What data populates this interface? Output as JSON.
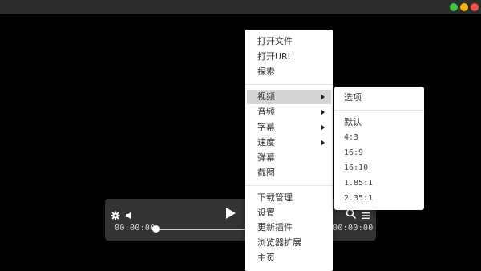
{
  "window": {
    "controls": [
      {
        "name": "green",
        "color": "#3fc24a"
      },
      {
        "name": "yellow",
        "color": "#f5b400"
      },
      {
        "name": "red",
        "color": "#f2504b"
      }
    ]
  },
  "player": {
    "current_time": "00:00:00",
    "total_time": "00:00:00",
    "progress": 0,
    "icons": [
      "gear-icon",
      "volume-icon",
      "play-icon",
      "search-icon",
      "playlist-icon"
    ]
  },
  "context_menu": {
    "items": [
      {
        "label": "打开文件"
      },
      {
        "label": "打开URL"
      },
      {
        "label": "探索"
      },
      {
        "label": "视频",
        "submenu": true,
        "highlighted": true
      },
      {
        "label": "音频",
        "submenu": true
      },
      {
        "label": "字幕",
        "submenu": true
      },
      {
        "label": "速度",
        "submenu": true
      },
      {
        "label": "弹幕"
      },
      {
        "label": "截图"
      },
      {
        "label": "下载管理"
      },
      {
        "label": "设置"
      },
      {
        "label": "更新插件"
      },
      {
        "label": "浏览器扩展"
      },
      {
        "label": "主页"
      }
    ]
  },
  "submenu": {
    "header": "选项",
    "items": [
      {
        "label": "默认"
      },
      {
        "label": "4:3"
      },
      {
        "label": "16:9"
      },
      {
        "label": "16:10"
      },
      {
        "label": "1.85:1"
      },
      {
        "label": "2.35:1"
      }
    ]
  }
}
